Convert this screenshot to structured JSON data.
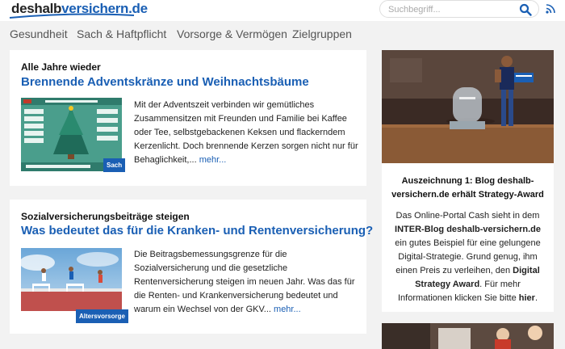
{
  "header": {
    "logo_part1": "deshalb",
    "logo_part2": "versichern.de",
    "search_placeholder": "Suchbegriff...",
    "icons": {
      "search": "search-icon",
      "rss": "rss-icon"
    },
    "colors": {
      "brand": "#1a5fb4",
      "background": "#f2f2f2"
    }
  },
  "nav": {
    "items": [
      "Gesundheit",
      "Sach & Haftpflicht",
      "Vorsorge & Vermögen",
      "Zielgruppen"
    ]
  },
  "articles": [
    {
      "kicker": "Alle Jahre wieder",
      "title": "Brennende Adventskränze und Weihnachtsbäume",
      "tag": "Sach",
      "lines": [
        "Mit der Adventszeit verbinden wir gemütliches",
        "Zusammensitzen mit Freunden und Familie bei Kaffee",
        "oder Tee, selbstgebackenen Keksen und flackerndem",
        "Kerzenlicht. Doch brennende Kerzen sorgen nicht nur für",
        "Behaglichkeit,..."
      ],
      "more": "mehr..."
    },
    {
      "kicker": "Sozialversicherungsbeiträge steigen",
      "title": "Was bedeutet das für die Kranken- und Rentenversicherung?",
      "tag": "Altersvorsorge",
      "lines": [
        "Die Beitragsbemessungsgrenze für die",
        "Sozialversicherung und die gesetzliche",
        "Rentenversicherung steigen im neuen Jahr. Was das für",
        "die Renten- und Krankenversicherung bedeutet und",
        "warum ein Wechsel von der GKV..."
      ],
      "more": "mehr..."
    }
  ],
  "sidebar": {
    "title": "Auszeichnung 1: Blog deshalb-versichern.de erhält Strategy-Award",
    "text_before": "Das Online-Portal Cash sieht in dem",
    "text_bold1": "INTER-Blog deshalb-versichern.de",
    "text_mid": "ein gutes Beispiel für eine gelungene Digital-Strategie. Grund genug, ihm einen Preis zu verleihen, den",
    "text_bold2": "Digital Strategy Award",
    "text_after": ". Für mehr Informationen klicken Sie bitte",
    "link": "hier",
    "end": "."
  }
}
